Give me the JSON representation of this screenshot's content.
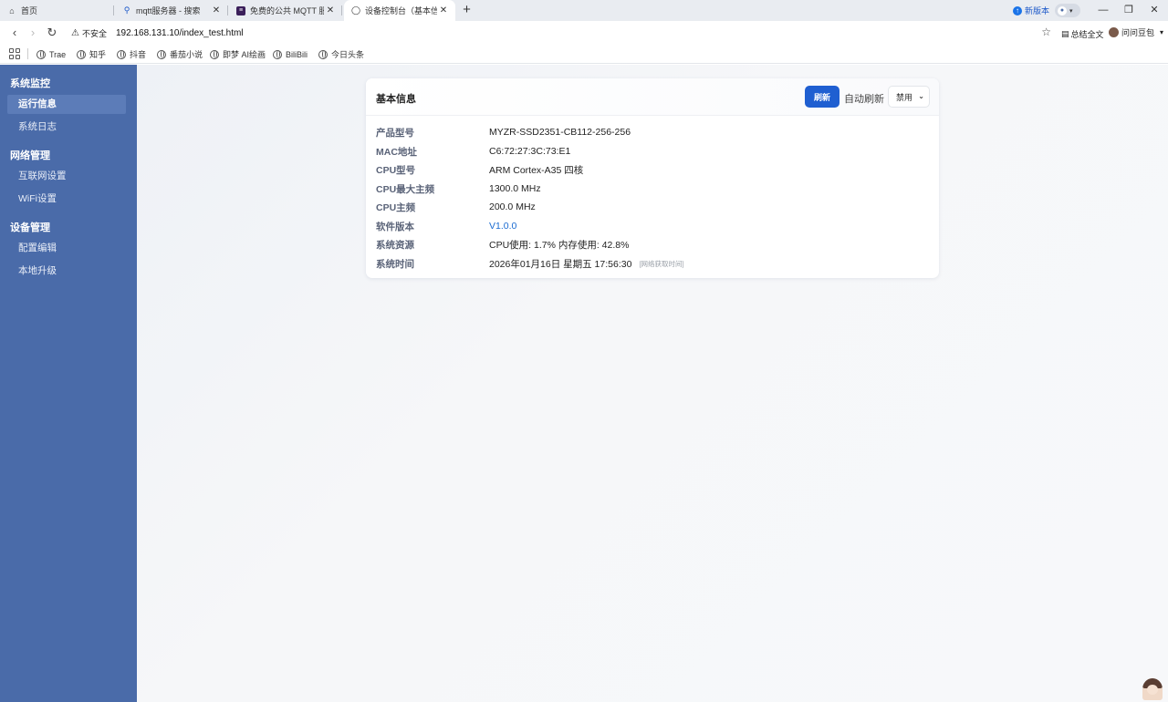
{
  "browser": {
    "tabs": [
      {
        "label": "首页",
        "icon": "home-icon"
      },
      {
        "label": "mqtt服务器 - 搜索",
        "icon": "search-icon"
      },
      {
        "label": "免费的公共 MQTT 服务",
        "icon": "doc-icon"
      },
      {
        "label": "设备控制台（基本信息",
        "icon": "globe-icon"
      }
    ],
    "new_version_label": "新版本",
    "insecure_label": "不安全",
    "url": "192.168.131.10/index_test.html",
    "summary_label": "总结全文",
    "doubao_label": "问问豆包",
    "bookmarks": [
      "Trae",
      "知乎",
      "抖音",
      "番茄小说",
      "即梦 AI绘画",
      "BiliBili",
      "今日头条"
    ]
  },
  "sidebar": {
    "groups": [
      {
        "title": "系统监控",
        "items": [
          "运行信息",
          "系统日志"
        ]
      },
      {
        "title": "网络管理",
        "items": [
          "互联网设置",
          "WiFi设置"
        ]
      },
      {
        "title": "设备管理",
        "items": [
          "配置编辑",
          "本地升级"
        ]
      }
    ],
    "active_item": "运行信息"
  },
  "card": {
    "title": "基本信息",
    "refresh_label": "刷新",
    "auto_refresh_label": "自动刷新",
    "auto_refresh_value": "禁用",
    "rows": [
      {
        "label": "产品型号",
        "value": "MYZR-SSD2351-CB112-256-256"
      },
      {
        "label": "MAC地址",
        "value": "C6:72:27:3C:73:E1"
      },
      {
        "label": "CPU型号",
        "value": "ARM Cortex-A35 四核"
      },
      {
        "label": "CPU最大主频",
        "value": "1300.0 MHz"
      },
      {
        "label": "CPU主频",
        "value": "200.0 MHz"
      },
      {
        "label": "软件版本",
        "value": "V1.0.0"
      },
      {
        "label": "系统资源",
        "value": "CPU使用: 1.7% 内存使用: 42.8%"
      },
      {
        "label": "系统时间",
        "value": "2026年01月16日 星期五 17:56:30",
        "note": "[网络获取时间]"
      }
    ]
  },
  "colors": {
    "sidebar_bg": "#4a6ba9",
    "primary_button": "#1f5fd1",
    "link": "#1a6bd1"
  }
}
